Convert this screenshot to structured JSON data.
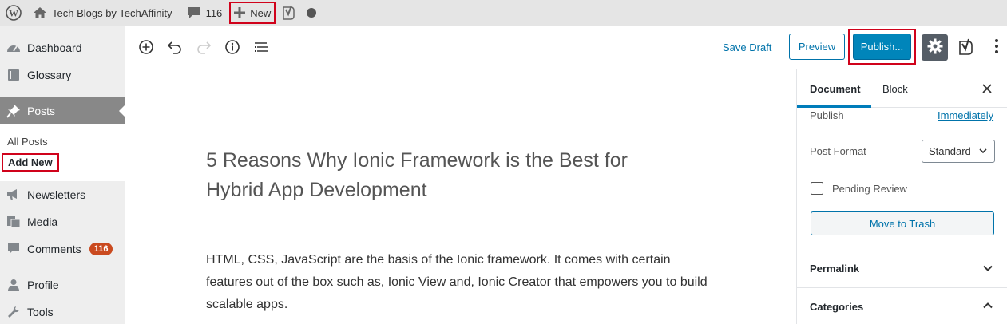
{
  "adminbar": {
    "site_name": "Tech Blogs by TechAffinity",
    "comments_count": "116",
    "new_label": "New"
  },
  "sidebar": {
    "items": [
      {
        "label": "Dashboard",
        "icon": "dashboard-icon"
      },
      {
        "label": "Glossary",
        "icon": "book-icon"
      },
      {
        "label": "Posts",
        "icon": "pin-icon"
      },
      {
        "label": "Newsletters",
        "icon": "megaphone-icon"
      },
      {
        "label": "Media",
        "icon": "media-icon"
      },
      {
        "label": "Comments",
        "icon": "comment-icon",
        "badge": "116"
      },
      {
        "label": "Profile",
        "icon": "user-icon"
      },
      {
        "label": "Tools",
        "icon": "wrench-icon"
      }
    ],
    "submenu": {
      "all_posts": "All Posts",
      "add_new": "Add New"
    }
  },
  "toolbar": {
    "save_draft": "Save Draft",
    "preview": "Preview",
    "publish": "Publish..."
  },
  "editor": {
    "title": "5 Reasons Why Ionic Framework is the Best for Hybrid App Development",
    "body": "HTML, CSS, JavaScript are the basis of the Ionic framework. It comes with certain features out of the box such as, Ionic View and, Ionic Creator that empowers you to build scalable apps."
  },
  "panel": {
    "tab_document": "Document",
    "tab_block": "Block",
    "publish_label": "Publish",
    "publish_value": "Immediately",
    "post_format_label": "Post Format",
    "post_format_value": "Standard",
    "pending_review": "Pending Review",
    "move_to_trash": "Move to Trash",
    "permalink": "Permalink",
    "categories": "Categories"
  },
  "colors": {
    "accent": "#0085ba",
    "link": "#0073aa",
    "highlight": "#d0021b",
    "badge": "#ca4a1f"
  }
}
